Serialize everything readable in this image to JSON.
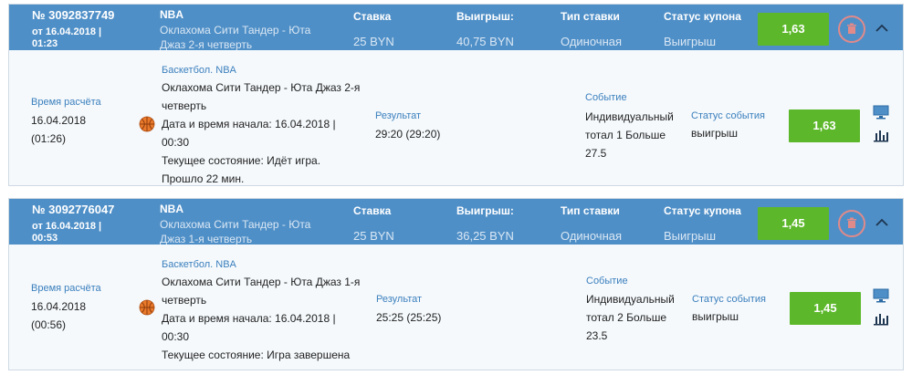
{
  "coupons": [
    {
      "number": "№ 3092837749",
      "date_line1": "от 16.04.2018 |",
      "date_line2": "01:23",
      "league": "NBA",
      "event_line1": "Оклахома Сити Тандер - Юта",
      "event_line2": "Джаз 2-я четверть",
      "stake_label": "Ставка",
      "stake_value": "25 BYN",
      "win_label": "Выигрыш:",
      "win_value": "40,75 BYN",
      "type_label": "Тип ставки",
      "type_value": "Одиночная",
      "status_label": "Статус купона",
      "status_value": "Выигрыш",
      "coef": "1,63",
      "detail": {
        "calc_label": "Время расчёта",
        "calc_date": "16.04.2018",
        "calc_time": "(01:26)",
        "sport_line": "Баскетбол. NBA",
        "match_line1": "Оклахома Сити Тандер - Юта Джаз 2-я",
        "match_line2": "четверть",
        "start_line1": "Дата и время начала: 16.04.2018 |",
        "start_line2": "00:30",
        "state_line1": "Текущее состояние: Идёт игра.",
        "state_line2": "Прошло 22 мин.",
        "result_label": "Результат",
        "result_value": "29:20 (29:20)",
        "event_label": "Событие",
        "event_line1": "Индивидуальный",
        "event_line2": "тотал 1 Больше",
        "event_line3": "27.5",
        "event_status_label": "Статус события",
        "event_status_value": "выигрыш",
        "coef": "1,63"
      }
    },
    {
      "number": "№ 3092776047",
      "date_line1": "от 16.04.2018 |",
      "date_line2": "00:53",
      "league": "NBA",
      "event_line1": "Оклахома Сити Тандер - Юта",
      "event_line2": "Джаз 1-я четверть",
      "stake_label": "Ставка",
      "stake_value": "25 BYN",
      "win_label": "Выигрыш:",
      "win_value": "36,25 BYN",
      "type_label": "Тип ставки",
      "type_value": "Одиночная",
      "status_label": "Статус купона",
      "status_value": "Выигрыш",
      "coef": "1,45",
      "detail": {
        "calc_label": "Время расчёта",
        "calc_date": "16.04.2018",
        "calc_time": "(00:56)",
        "sport_line": "Баскетбол. NBA",
        "match_line1": "Оклахома Сити Тандер - Юта Джаз 1-я",
        "match_line2": "четверть",
        "start_line1": "Дата и время начала: 16.04.2018 |",
        "start_line2": "00:30",
        "state_line1": "Текущее состояние: Игра завершена",
        "state_line2": "",
        "result_label": "Результат",
        "result_value": "25:25 (25:25)",
        "event_label": "Событие",
        "event_line1": "Индивидуальный",
        "event_line2": "тотал 2 Больше",
        "event_line3": "23.5",
        "event_status_label": "Статус события",
        "event_status_value": "выигрыш",
        "coef": "1,45"
      }
    }
  ],
  "colors": {
    "header": "#4f8fc7",
    "coef": "#5cb82a",
    "delete": "#e08a8a"
  },
  "icons": [
    "trash-icon",
    "chevron-up-icon",
    "basketball-icon",
    "tv-icon",
    "stats-icon"
  ]
}
